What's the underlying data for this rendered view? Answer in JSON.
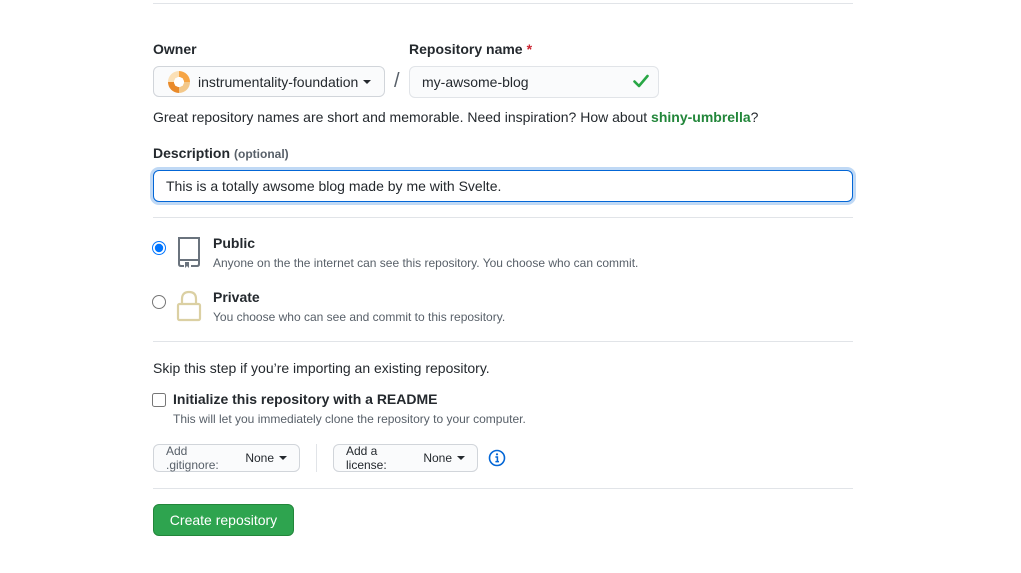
{
  "owner": {
    "label": "Owner",
    "value": "instrumentality-foundation"
  },
  "repo_name": {
    "label": "Repository name",
    "required_mark": "*",
    "value": "my-awsome-blog"
  },
  "slash": "/",
  "hint": {
    "text": "Great repository names are short and memorable. Need inspiration? How about ",
    "suggestion": "shiny-umbrella",
    "suffix": "?"
  },
  "description": {
    "label": "Description",
    "optional": "(optional)",
    "value": "This is a totally awsome blog made by me with Svelte."
  },
  "visibility": {
    "selected": "public",
    "public": {
      "title": "Public",
      "subtitle": "Anyone on the the internet can see this repository. You choose who can commit."
    },
    "private": {
      "title": "Private",
      "subtitle": "You choose who can see and commit to this repository."
    }
  },
  "init": {
    "skip_text": "Skip this step if you’re importing an existing repository.",
    "readme_label": "Initialize this repository with a README",
    "readme_sub": "This will let you immediately clone the repository to your computer.",
    "readme_checked": false,
    "gitignore_prefix": "Add .gitignore:",
    "gitignore_value": "None",
    "license_prefix": "Add a license:",
    "license_value": "None"
  },
  "create_button": "Create repository",
  "colors": {
    "accent": "#0366d6",
    "success": "#2ea44f",
    "suggestion": "#22863a",
    "required": "#cb2431"
  }
}
